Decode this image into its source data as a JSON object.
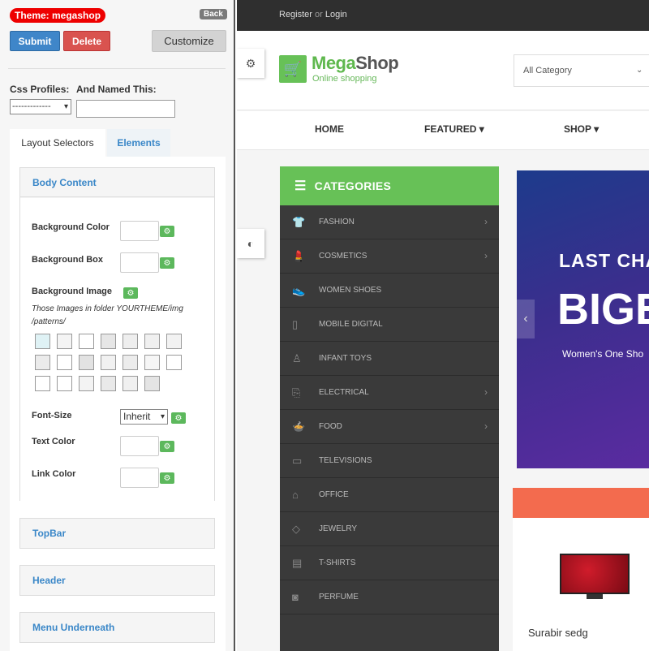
{
  "editor": {
    "theme_badge": "Theme: megashop",
    "back_label": "Back",
    "submit_label": "Submit",
    "delete_label": "Delete",
    "customize_label": "Customize",
    "css_profiles_label": "Css Profiles:",
    "named_label": "And Named This:",
    "profile_selected": "-------------",
    "tabs": [
      {
        "label": "Layout Selectors"
      },
      {
        "label": "Elements"
      }
    ],
    "body_panel": {
      "title": "Body Content",
      "background_color_label": "Background Color",
      "background_box_label": "Background Box",
      "background_image_label": "Background Image",
      "images_hint": "Those Images in folder YOURTHEME/img /patterns/",
      "font_size_label": "Font-Size",
      "font_size_value": "Inherit",
      "text_color_label": "Text Color",
      "link_color_label": "Link Color"
    },
    "panels": [
      {
        "title": "TopBar"
      },
      {
        "title": "Header"
      },
      {
        "title": "Menu Underneath"
      }
    ],
    "colors": {
      "submit": "#3f86c9",
      "delete": "#d9534f",
      "badge": "#ee0000",
      "gear": "#5cb85c"
    }
  },
  "site": {
    "register": "Register",
    "or": "or",
    "login": "Login",
    "logo_name_m": "Mega",
    "logo_name_rest": "Shop",
    "logo_tagline": "Online shopping",
    "category_select": "All Category",
    "nav": [
      {
        "label": "HOME"
      },
      {
        "label": "FEATURED ▾"
      },
      {
        "label": "SHOP ▾"
      }
    ],
    "categories_title": "CATEGORIES",
    "categories": [
      {
        "label": "FASHION",
        "icon": "shirt-icon",
        "arrow": true
      },
      {
        "label": "COSMETICS",
        "icon": "lipstick-icon",
        "arrow": true
      },
      {
        "label": "WOMEN SHOES",
        "icon": "shoe-icon",
        "arrow": false
      },
      {
        "label": "MOBILE DIGITAL",
        "icon": "phone-icon",
        "arrow": false
      },
      {
        "label": "INFANT TOYS",
        "icon": "toy-icon",
        "arrow": false
      },
      {
        "label": "ELECTRICAL",
        "icon": "plug-icon",
        "arrow": true
      },
      {
        "label": "FOOD",
        "icon": "food-icon",
        "arrow": true
      },
      {
        "label": "TELEVISIONS",
        "icon": "tv-icon",
        "arrow": false
      },
      {
        "label": "OFFICE",
        "icon": "office-icon",
        "arrow": false
      },
      {
        "label": "JEWELRY",
        "icon": "diamond-icon",
        "arrow": false
      },
      {
        "label": "T-SHIRTS",
        "icon": "sofa-icon",
        "arrow": false
      },
      {
        "label": "PERFUME",
        "icon": "camera-icon",
        "arrow": false
      }
    ],
    "banner": {
      "line1": "LAST CHA",
      "line2": "BIGE",
      "line3": "Women's One Sho"
    },
    "product_name": "Surabir sedg",
    "colors": {
      "topbar": "#2f2f2f",
      "brand_green": "#67c157",
      "sidebar": "#3a3a3a",
      "promo": "#f36b4e"
    }
  }
}
